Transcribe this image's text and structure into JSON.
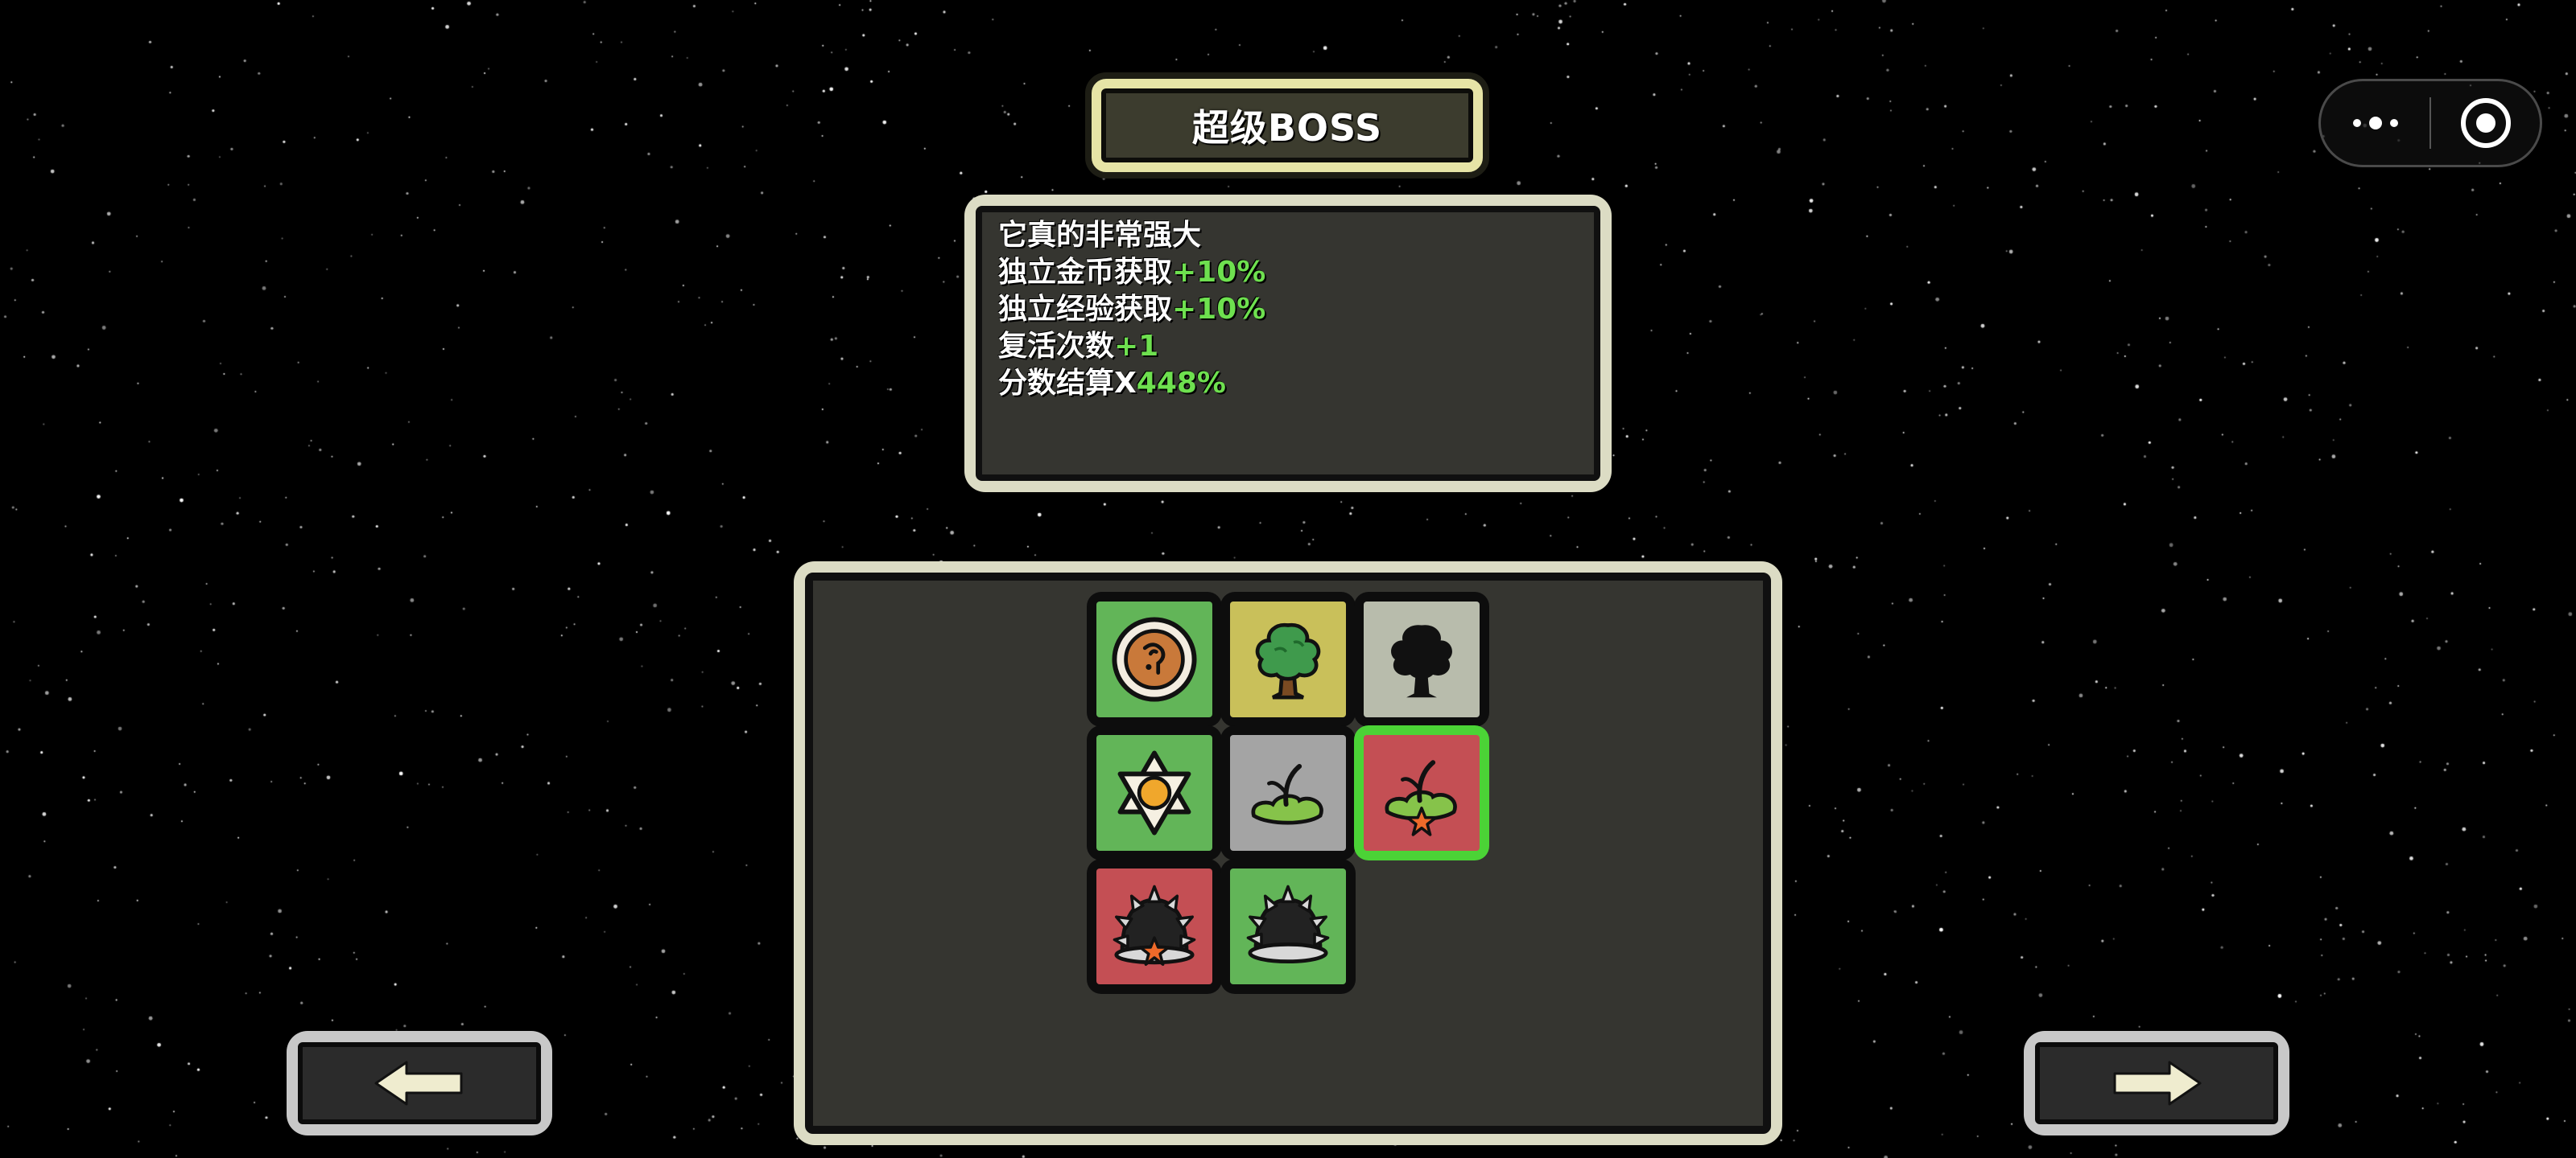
{
  "title": "超级BOSS",
  "description": {
    "lines": [
      {
        "text": "它真的非常强大",
        "value": ""
      },
      {
        "text": "独立金币获取",
        "value": "+10%"
      },
      {
        "text": "独立经验获取",
        "value": "+10%"
      },
      {
        "text": "复活次数",
        "value": "+1"
      },
      {
        "text": "分数结算X",
        "value": "448%"
      }
    ]
  },
  "colors": {
    "highlight": "#6ee04f",
    "tile_green": "#62b558",
    "tile_yellow": "#c9c05a",
    "tile_gray": "#a4a4a4",
    "tile_light_gray": "#b8bcac",
    "tile_red": "#c44f54",
    "selected_border": "#4bd336",
    "panel_bg": "#353530",
    "frame": "#dcdcc4"
  },
  "items": [
    {
      "icon": "coin-icon",
      "bg": "green",
      "selected": false
    },
    {
      "icon": "tree-icon",
      "bg": "yellow",
      "selected": false
    },
    {
      "icon": "tree-silhouette-icon",
      "bg": "light-gray",
      "selected": false
    },
    {
      "icon": "sun-star-icon",
      "bg": "green",
      "selected": false
    },
    {
      "icon": "sprout-icon",
      "bg": "gray",
      "selected": false
    },
    {
      "icon": "sprout-star-icon",
      "bg": "red",
      "selected": true
    },
    {
      "icon": "spiked-dome-star-icon",
      "bg": "red",
      "selected": false
    },
    {
      "icon": "spiked-dome-icon",
      "bg": "green",
      "selected": false
    }
  ],
  "nav": {
    "prev_icon": "arrow-left-icon",
    "next_icon": "arrow-right-icon"
  },
  "capsule": {
    "menu_icon": "more-dots-icon",
    "close_icon": "target-circle-icon"
  }
}
